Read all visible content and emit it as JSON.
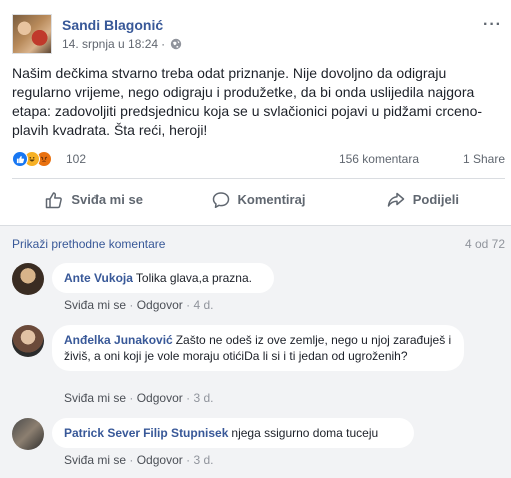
{
  "post": {
    "author": "Sandi Blagonić",
    "date": "14. srpnja u 18:24",
    "separator": "·",
    "text": "Našim dečkima stvarno treba odat priznanje. Nije dovoljno da odigraju regularno vrijeme, nego odigraju i produžetke, da bi onda uslijedila najgora etapa: zadovoljiti predsjednicu koja se u svlačionici pojavi u pidžami crceno-plavih kvadrata. Šta reći, heroji!",
    "reaction_count": "102",
    "reaction_icons": [
      "like-icon",
      "haha-icon",
      "angry-icon"
    ],
    "comments_count": "156 komentara",
    "shares_count": "1 Share",
    "more_icon": "···"
  },
  "actions": {
    "like": "Sviđa mi se",
    "comment": "Komentiraj",
    "share": "Podijeli"
  },
  "comments_section": {
    "previous_link": "Prikaži prethodne komentare",
    "pager": "4 od 72",
    "like_label": "Sviđa mi se",
    "reply_label": "Odgovor",
    "dot": "·",
    "items": [
      {
        "name": "Ante Vukoja",
        "text": "Tolika glava,a prazna.",
        "age": "4 d."
      },
      {
        "name": "Anđelka Junaković",
        "text": "Zašto ne odeš iz ove zemlje, nego u njoj zarađuješ i živiš, a oni koji je vole moraju otići",
        "text2": "Da li si i ti jedan od ugroženih?",
        "age": "3 d."
      },
      {
        "name": "Patrick Sever",
        "tag": "Filip Stupnisek",
        "text": "njega ssigurno doma tuceju",
        "age": "3 d."
      }
    ]
  },
  "colors": {
    "link_blue": "#385898",
    "text": "#1d2129",
    "muted": "#606770",
    "comment_bg": "#f2f3f5"
  }
}
